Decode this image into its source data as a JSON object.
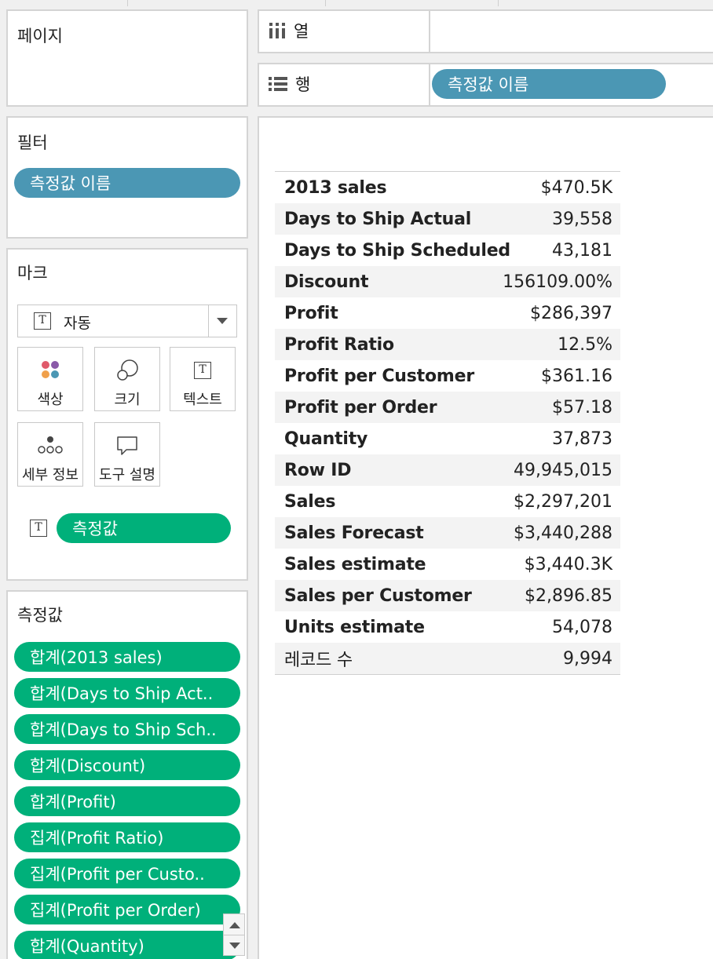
{
  "pages": {
    "title": "페이지"
  },
  "filters": {
    "title": "필터",
    "pill": "측정값 이름"
  },
  "marks": {
    "title": "마크",
    "type_label": "자동",
    "buttons": [
      {
        "label": "색상",
        "icon": "color-dots-icon"
      },
      {
        "label": "크기",
        "icon": "size-circles-icon"
      },
      {
        "label": "텍스트",
        "icon": "text-t-icon"
      },
      {
        "label": "세부 정보",
        "icon": "detail-dots-icon"
      },
      {
        "label": "도구 설명",
        "icon": "tooltip-bubble-icon"
      }
    ],
    "text_pill": "측정값"
  },
  "measure_values": {
    "title": "측정값",
    "items": [
      "합계(2013 sales)",
      "합계(Days to Ship Act..",
      "합계(Days to Ship Sch..",
      "합계(Discount)",
      "합계(Profit)",
      "집계(Profit Ratio)",
      "집계(Profit per Custo..",
      "집계(Profit per Order)",
      "합계(Quantity)"
    ]
  },
  "shelves": {
    "columns_label": "열",
    "rows_label": "행",
    "rows_pill": "측정값 이름"
  },
  "colors": {
    "blue_pill": "#4b97b4",
    "green_pill": "#00b07a"
  },
  "table": {
    "rows": [
      {
        "name": "2013 sales",
        "value": "$470.5K"
      },
      {
        "name": "Days to Ship Actual",
        "value": "39,558"
      },
      {
        "name": "Days to Ship Scheduled",
        "value": "43,181"
      },
      {
        "name": "Discount",
        "value": "156109.00%"
      },
      {
        "name": "Profit",
        "value": "$286,397"
      },
      {
        "name": "Profit Ratio",
        "value": "12.5%"
      },
      {
        "name": "Profit per Customer",
        "value": "$361.16"
      },
      {
        "name": "Profit per Order",
        "value": "$57.18"
      },
      {
        "name": "Quantity",
        "value": "37,873"
      },
      {
        "name": "Row ID",
        "value": "49,945,015"
      },
      {
        "name": "Sales",
        "value": "$2,297,201"
      },
      {
        "name": "Sales Forecast",
        "value": "$3,440,288"
      },
      {
        "name": "Sales estimate",
        "value": "$3,440.3K"
      },
      {
        "name": "Sales per Customer",
        "value": "$2,896.85"
      },
      {
        "name": "Units estimate",
        "value": "54,078"
      },
      {
        "name": "레코드 수",
        "value": "9,994"
      }
    ]
  }
}
